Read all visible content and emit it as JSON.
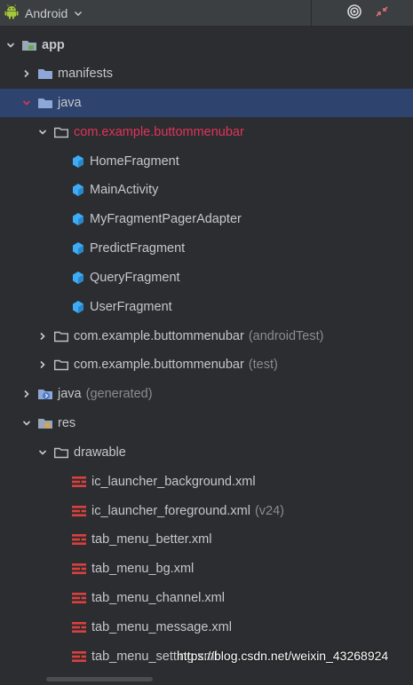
{
  "toolbar": {
    "view_label": "Android",
    "view_icon": "android-icon",
    "dropdown_icon": "chevron-down-icon",
    "locate_icon": "target-icon",
    "collapse_icon": "collapse-all-icon"
  },
  "tree": [
    {
      "label": "app",
      "bold": true,
      "expanded": true,
      "icon": "module-folder-icon"
    },
    {
      "label": "manifests",
      "expanded": false,
      "icon": "folder-icon"
    },
    {
      "label": "java",
      "expanded": true,
      "selected": true,
      "icon": "folder-icon"
    },
    {
      "label": "com.example.buttommenubar",
      "expanded": true,
      "icon": "package-icon",
      "red": true
    },
    {
      "label": "HomeFragment",
      "icon": "class-icon"
    },
    {
      "label": "MainActivity",
      "icon": "class-icon"
    },
    {
      "label": "MyFragmentPagerAdapter",
      "icon": "class-icon"
    },
    {
      "label": "PredictFragment",
      "icon": "class-icon"
    },
    {
      "label": "QueryFragment",
      "icon": "class-icon"
    },
    {
      "label": "UserFragment",
      "icon": "class-icon"
    },
    {
      "label": "com.example.buttommenubar",
      "suffix": "(androidTest)",
      "expanded": false,
      "icon": "package-icon"
    },
    {
      "label": "com.example.buttommenubar",
      "suffix": "(test)",
      "expanded": false,
      "icon": "package-icon"
    },
    {
      "label": "java",
      "suffix": "(generated)",
      "expanded": false,
      "icon": "generated-folder-icon"
    },
    {
      "label": "res",
      "expanded": true,
      "icon": "resource-folder-icon"
    },
    {
      "label": "drawable",
      "expanded": true,
      "icon": "package-icon"
    },
    {
      "label": "ic_launcher_background.xml",
      "icon": "xml-file-icon"
    },
    {
      "label": "ic_launcher_foreground.xml",
      "suffix": "(v24)",
      "icon": "xml-file-icon"
    },
    {
      "label": "tab_menu_better.xml",
      "icon": "xml-file-icon"
    },
    {
      "label": "tab_menu_bg.xml",
      "icon": "xml-file-icon"
    },
    {
      "label": "tab_menu_channel.xml",
      "icon": "xml-file-icon"
    },
    {
      "label": "tab_menu_message.xml",
      "icon": "xml-file-icon"
    },
    {
      "label": "tab_menu_setting.xml",
      "icon": "xml-file-icon"
    }
  ],
  "watermark": "https://blog.csdn.net/weixin_43268924",
  "colors": {
    "background": "#2b2d30",
    "selection": "#2e436e",
    "package_red": "#e0335a",
    "class_icon": "#3dabf5",
    "folder": "#8fa7d6",
    "xml_icon": "#d9413f"
  }
}
